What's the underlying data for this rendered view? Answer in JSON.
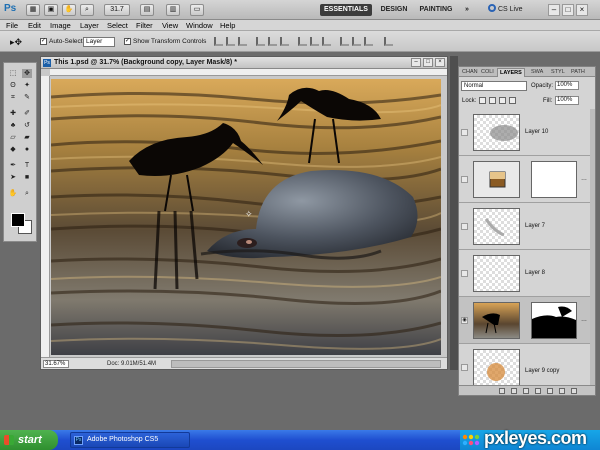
{
  "app": {
    "logo": "Ps",
    "zoom_value": "31.7",
    "workspaces": [
      "ESSENTIALS",
      "DESIGN",
      "PAINTING"
    ],
    "more": "»",
    "cs_live": "CS Live"
  },
  "menu": [
    "File",
    "Edit",
    "Image",
    "Layer",
    "Select",
    "Filter",
    "View",
    "Window",
    "Help"
  ],
  "options_bar": {
    "auto_select_label": "Auto-Select:",
    "auto_select_value": "Layer",
    "transform_controls_label": "Show Transform Controls"
  },
  "document": {
    "title": "This 1.psd @ 31.7% (Background copy, Layer Mask/8) *",
    "zoom": "31.67%",
    "doc_info": "Doc: 9.01M/51.4M"
  },
  "layers_panel": {
    "tabs": [
      "CHAN",
      "COLI",
      "LAYERS",
      "SWA",
      "STYL",
      "PATH"
    ],
    "active_tab": "LAYERS",
    "blend_mode": "Normal",
    "opacity_label": "Opacity:",
    "opacity_value": "100%",
    "lock_label": "Lock:",
    "fill_label": "Fill:",
    "fill_value": "100%",
    "layers": [
      {
        "name": "Layer 10"
      },
      {
        "name": ""
      },
      {
        "name": "Layer 7"
      },
      {
        "name": "Layer 8"
      },
      {
        "name": ""
      },
      {
        "name": "Layer 9 copy"
      }
    ]
  },
  "taskbar": {
    "start_label": "start",
    "task_label": "Adobe Photoshop CS5"
  },
  "watermark": "pxleyes.com"
}
